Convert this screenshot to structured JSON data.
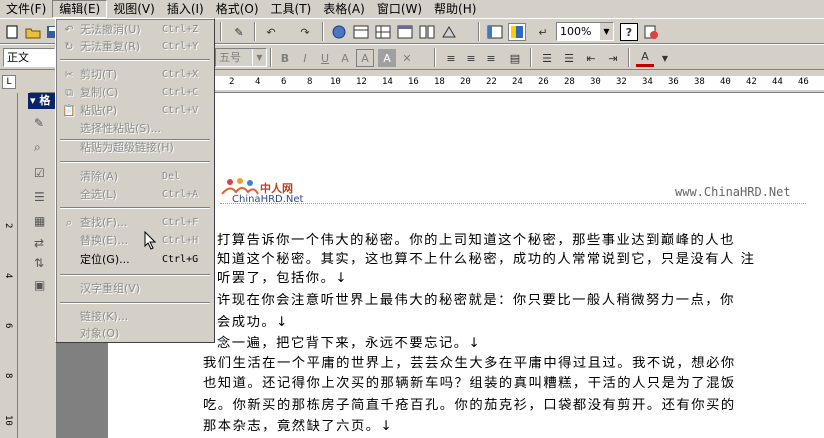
{
  "menubar": {
    "items": [
      "文件(F)",
      "编辑(E)",
      "视图(V)",
      "插入(I)",
      "格式(O)",
      "工具(T)",
      "表格(A)",
      "窗口(W)",
      "帮助(H)"
    ],
    "active_index": 1
  },
  "toolbar": {
    "zoom": "100%",
    "style": "正文",
    "font_size": "五号"
  },
  "edit_menu": {
    "undo": {
      "label": "无法撤消(U)",
      "shortcut": "Ctrl+Z"
    },
    "redo": {
      "label": "无法重复(R)",
      "shortcut": "Ctrl+Y"
    },
    "cut": {
      "label": "剪切(T)",
      "shortcut": "Ctrl+X"
    },
    "copy": {
      "label": "复制(C)",
      "shortcut": "Ctrl+C"
    },
    "paste": {
      "label": "粘贴(P)",
      "shortcut": "Ctrl+V"
    },
    "paste_special": {
      "label": "选择性粘贴(S)..."
    },
    "paste_hyperlink": {
      "label": "粘贴为超级链接(H)"
    },
    "clear": {
      "label": "清除(A)",
      "shortcut": "Del"
    },
    "select_all": {
      "label": "全选(L)",
      "shortcut": "Ctrl+A"
    },
    "find": {
      "label": "查找(F)...",
      "shortcut": "Ctrl+F"
    },
    "replace": {
      "label": "替换(E)...",
      "shortcut": "Ctrl+H"
    },
    "goto": {
      "label": "定位(G)...",
      "shortcut": "Ctrl+G"
    },
    "reconvert": {
      "label": "汉字重组(V)"
    },
    "links": {
      "label": "链接(K)..."
    },
    "object": {
      "label": "对象(O)"
    }
  },
  "ruler": {
    "ticks": [
      "2",
      "4",
      "6",
      "8",
      "10",
      "12",
      "14",
      "16",
      "18",
      "20",
      "22",
      "24",
      "26",
      "28",
      "30",
      "32",
      "34",
      "36",
      "38",
      "40",
      "42",
      "44",
      "46"
    ],
    "vticks": [
      "2",
      "4",
      "6",
      "8",
      "10"
    ]
  },
  "pane": {
    "title": "格"
  },
  "document": {
    "logo_name": "中人网",
    "logo_url": "ChinaHRD.Net",
    "site_url": "www.ChinaHRD.Net",
    "paragraphs": [
      "打算告诉你一个伟大的秘密。你的上司知道这个秘密，那些事业达到巅峰的人也",
      "知道这个秘密。其实，这也算不上什么秘密，成功的人常常说到它，只是没有人 注",
      "听罢了，包括你。↓",
      "许现在你会注意听世界上最伟大的秘密就是：你只要比一般人稍微努力一点，你",
      "会成功。↓",
      "念一遍，把它背下来，永远不要忘记。↓",
      "我们生活在一个平庸的世界上，芸芸众生大多在平庸中得过且过。我不说，想必你",
      "也知道。还记得你上次买的那辆新车吗？组装的真叫糟糕，干活的人只是为了混饭",
      "吃。你新买的那栋房子简直千疮百孔。你的茄克衫，口袋都没有剪开。还有你买的",
      "那本杂志，竟然缺了六页。↓"
    ]
  }
}
